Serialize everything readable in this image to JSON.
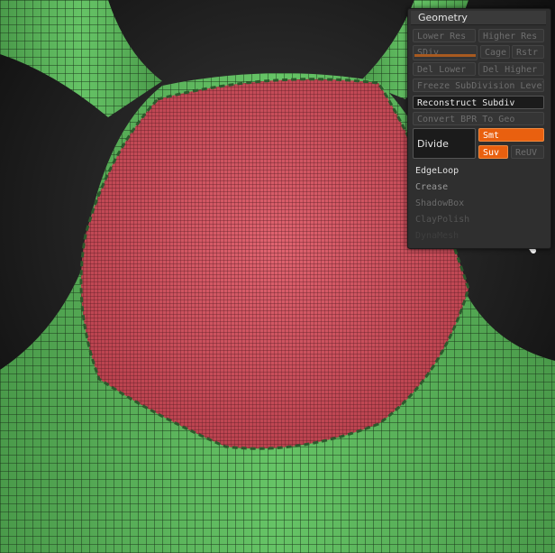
{
  "panel": {
    "title": "Geometry",
    "lower_res": "Lower Res",
    "higher_res": "Higher Res",
    "sdiv": "SDiv",
    "cage": "Cage",
    "rstr": "Rstr",
    "del_lower": "Del Lower",
    "del_higher": "Del Higher",
    "freeze": "Freeze SubDivision Level",
    "reconstruct": "Reconstruct Subdiv",
    "convert": "Convert BPR To Geo",
    "divide": "Divide",
    "smt": "Smt",
    "suv": "Suv",
    "reuv": "ReUV",
    "edgeloop": "EdgeLoop",
    "crease": "Crease",
    "shadowbox": "ShadowBox",
    "claypolish": "ClayPolish",
    "dynamesh": "DynaMesh"
  },
  "colors": {
    "mesh_green": "#5ab85a",
    "masked_red": "#d6505c",
    "accent_orange": "#e9600f",
    "panel_bg": "#2f2f2f"
  }
}
